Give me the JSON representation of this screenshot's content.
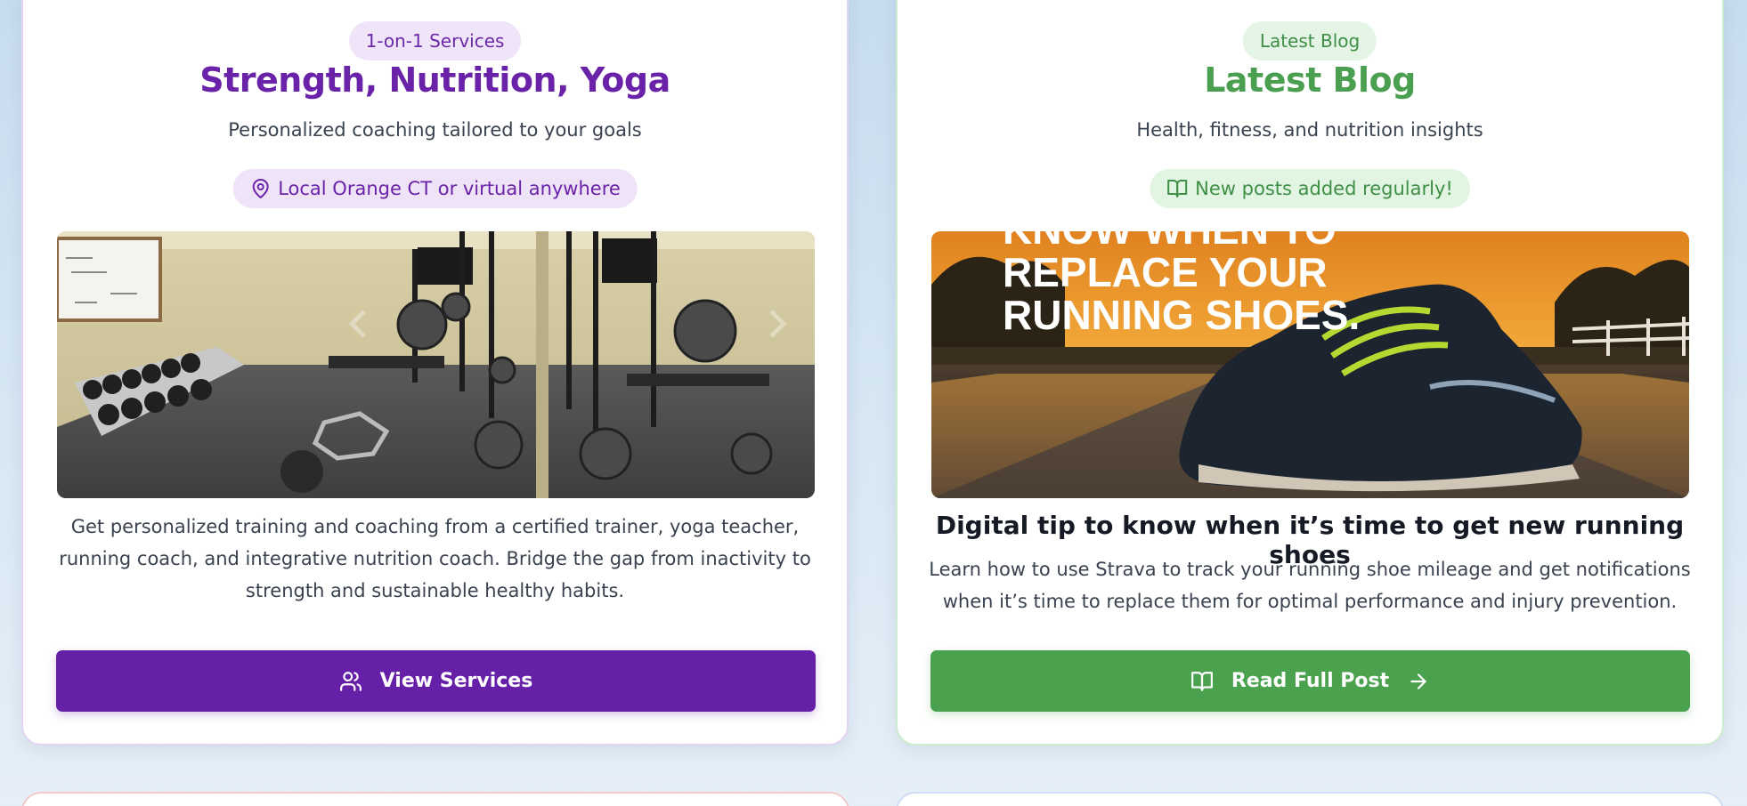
{
  "services_card": {
    "badge": "1-on-1 Services",
    "title": "Strength, Nutrition, Yoga",
    "subtitle": "Personalized coaching tailored to your goals",
    "location_tag": "Local Orange CT or virtual anywhere",
    "location_icon": "map-pin-icon",
    "image_alt": "Home gym with weights, squat racks and mirror",
    "description": "Get personalized training and coaching from a certified trainer, yoga teacher, running coach, and integrative nutrition coach. Bridge the gap from inactivity to strength and sustainable healthy habits.",
    "button_label": "View Services",
    "button_icon": "users-icon",
    "accent_color": "#6620a8"
  },
  "blog_card": {
    "badge": "Latest Blog",
    "title": "Latest Blog",
    "subtitle": "Health, fitness, and nutrition insights",
    "posts_tag": "New posts added regularly!",
    "posts_icon": "book-open-icon",
    "image_overlay_lines": [
      "KNOW WHEN TO",
      "REPLACE YOUR",
      "RUNNING SHOES."
    ],
    "post_title": "Digital tip to know when it’s time to get new running shoes",
    "post_excerpt": "Learn how to use Strava to track your running shoe mileage and get notifications when it’s time to replace them for optimal performance and injury prevention.",
    "button_label": "Read Full Post",
    "button_icon": "book-open-icon",
    "button_trailing_icon": "arrow-right-icon",
    "accent_color": "#4aa24f"
  }
}
